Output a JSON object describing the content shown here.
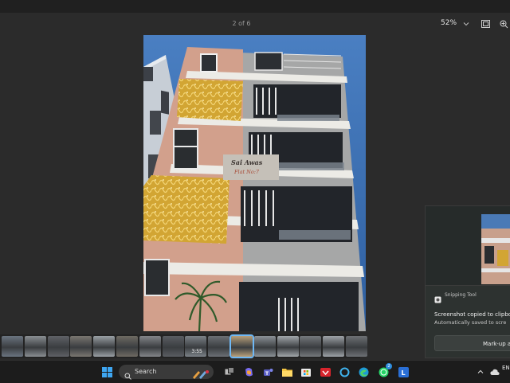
{
  "viewer": {
    "page_counter": "2 of 6",
    "zoom_level": "52%",
    "toolbar_icons": [
      "chevron-down-icon",
      "fit-to-window-icon",
      "zoom-in-icon"
    ]
  },
  "photo": {
    "sign_line1": "Sai Awas",
    "sign_line2": "Flat No:7"
  },
  "filmstrip": {
    "thumb_count": 16,
    "selected_index": 10,
    "thumb_label": "3:55"
  },
  "snipping_toast": {
    "app_name": "Snipping Tool",
    "title": "Screenshot copied to clipbo",
    "subtitle": "Automatically saved to scre",
    "action_label": "Mark-up a"
  },
  "taskbar": {
    "search_placeholder": "Search",
    "whatsapp_badge": "2",
    "tray_text": "EN"
  },
  "colors": {
    "toolbar_bg": "#2b2b2b",
    "taskbar_bg": "#1c1c1c",
    "accent": "#6fb8f5"
  }
}
